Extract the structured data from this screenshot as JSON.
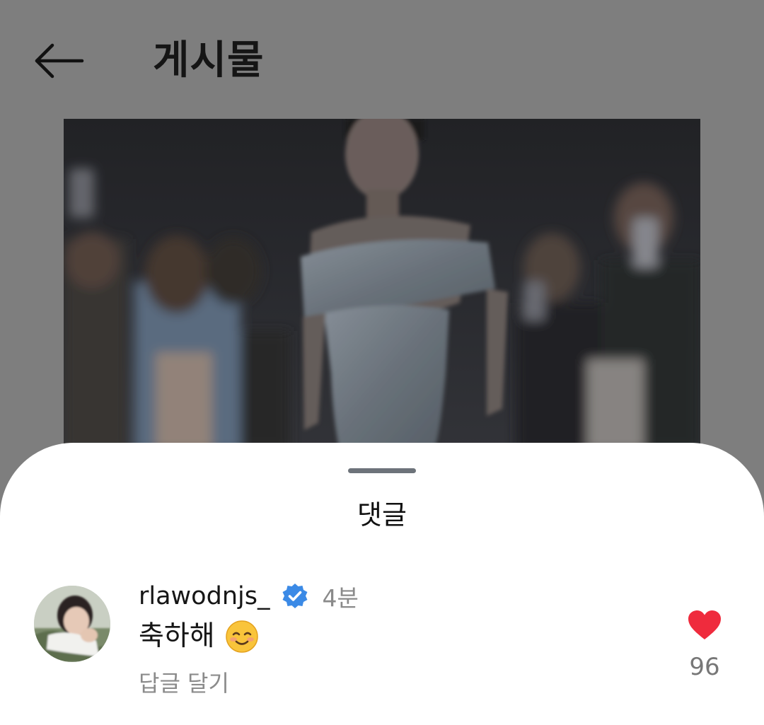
{
  "header": {
    "title": "게시물",
    "back_icon": "arrow-left-icon"
  },
  "post": {
    "image_alt": "photo"
  },
  "comments_sheet": {
    "title": "댓글",
    "comments": [
      {
        "username": "rlawodnjs_",
        "verified": true,
        "time": "4분",
        "text": "축하해",
        "emoji": "smiling-face-icon",
        "reply_label": "답글 달기",
        "like_count": "96",
        "liked": true
      }
    ]
  },
  "colors": {
    "overlay": "#7e7e7e",
    "verified_blue": "#3a8be8",
    "like_red": "#ee2a3c",
    "muted_text": "#8a8a8a"
  }
}
